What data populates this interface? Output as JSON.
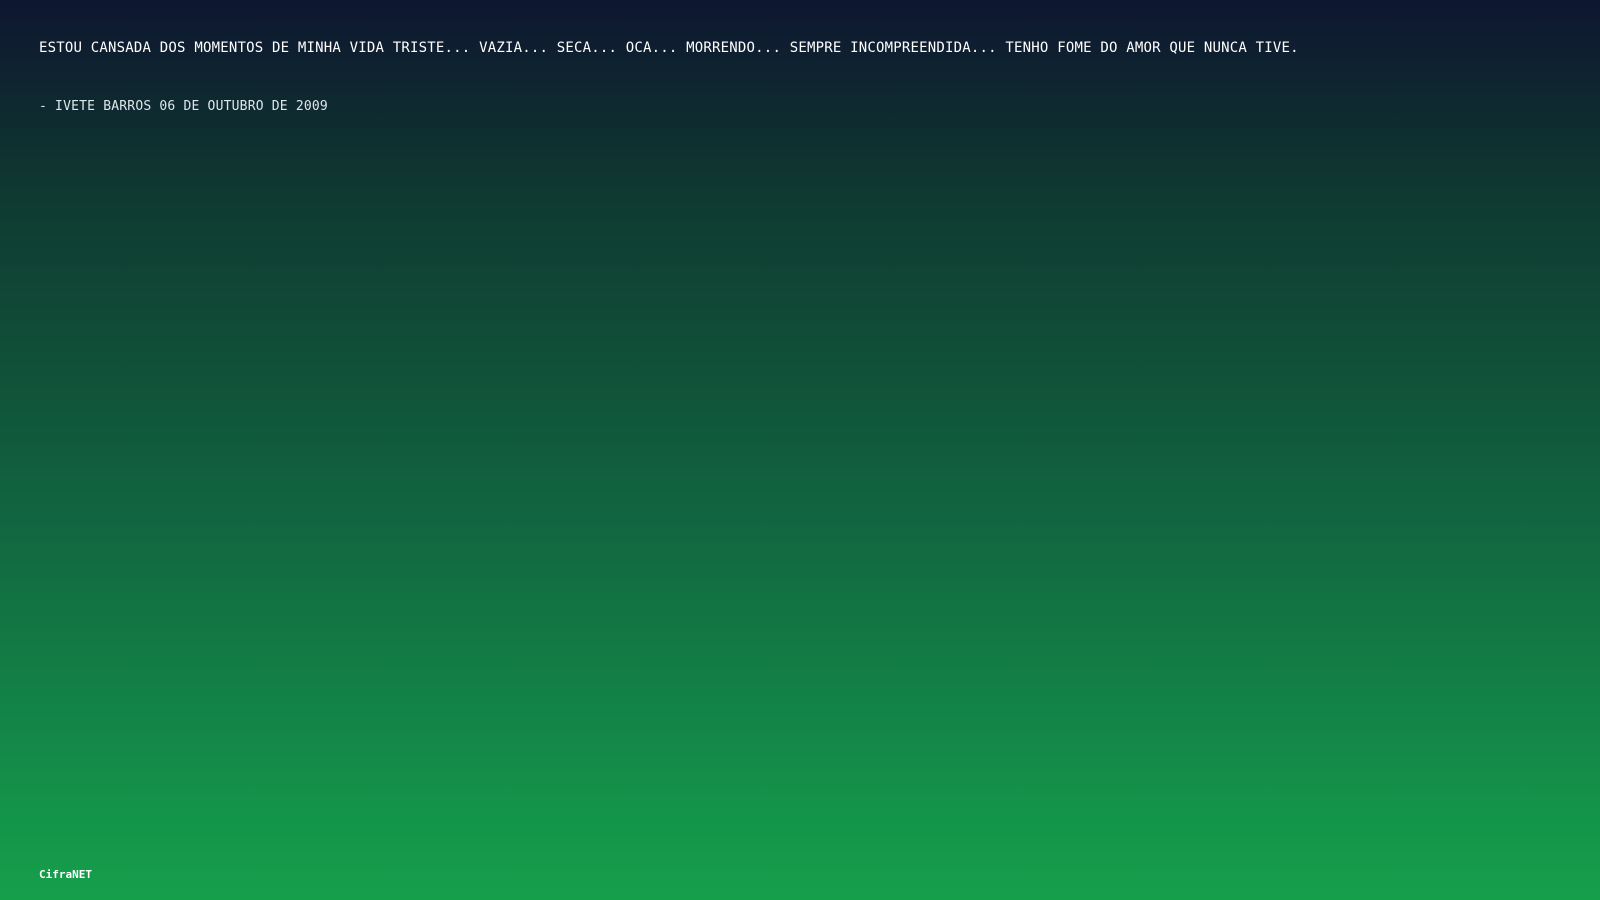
{
  "quote": {
    "text": "ESTOU CANSADA DOS MOMENTOS DE MINHA VIDA TRISTE... VAZIA... SECA... OCA... MORRENDO... SEMPRE INCOMPREENDIDA... TENHO FOME DO AMOR QUE NUNCA TIVE.",
    "attribution": "- IVETE BARROS 06 DE OUTUBRO DE 2009"
  },
  "brand": {
    "name": "CifraNET"
  },
  "colors": {
    "background_top": "#0e1630",
    "background_bottom": "#169f4b",
    "text": "#ffffff"
  }
}
